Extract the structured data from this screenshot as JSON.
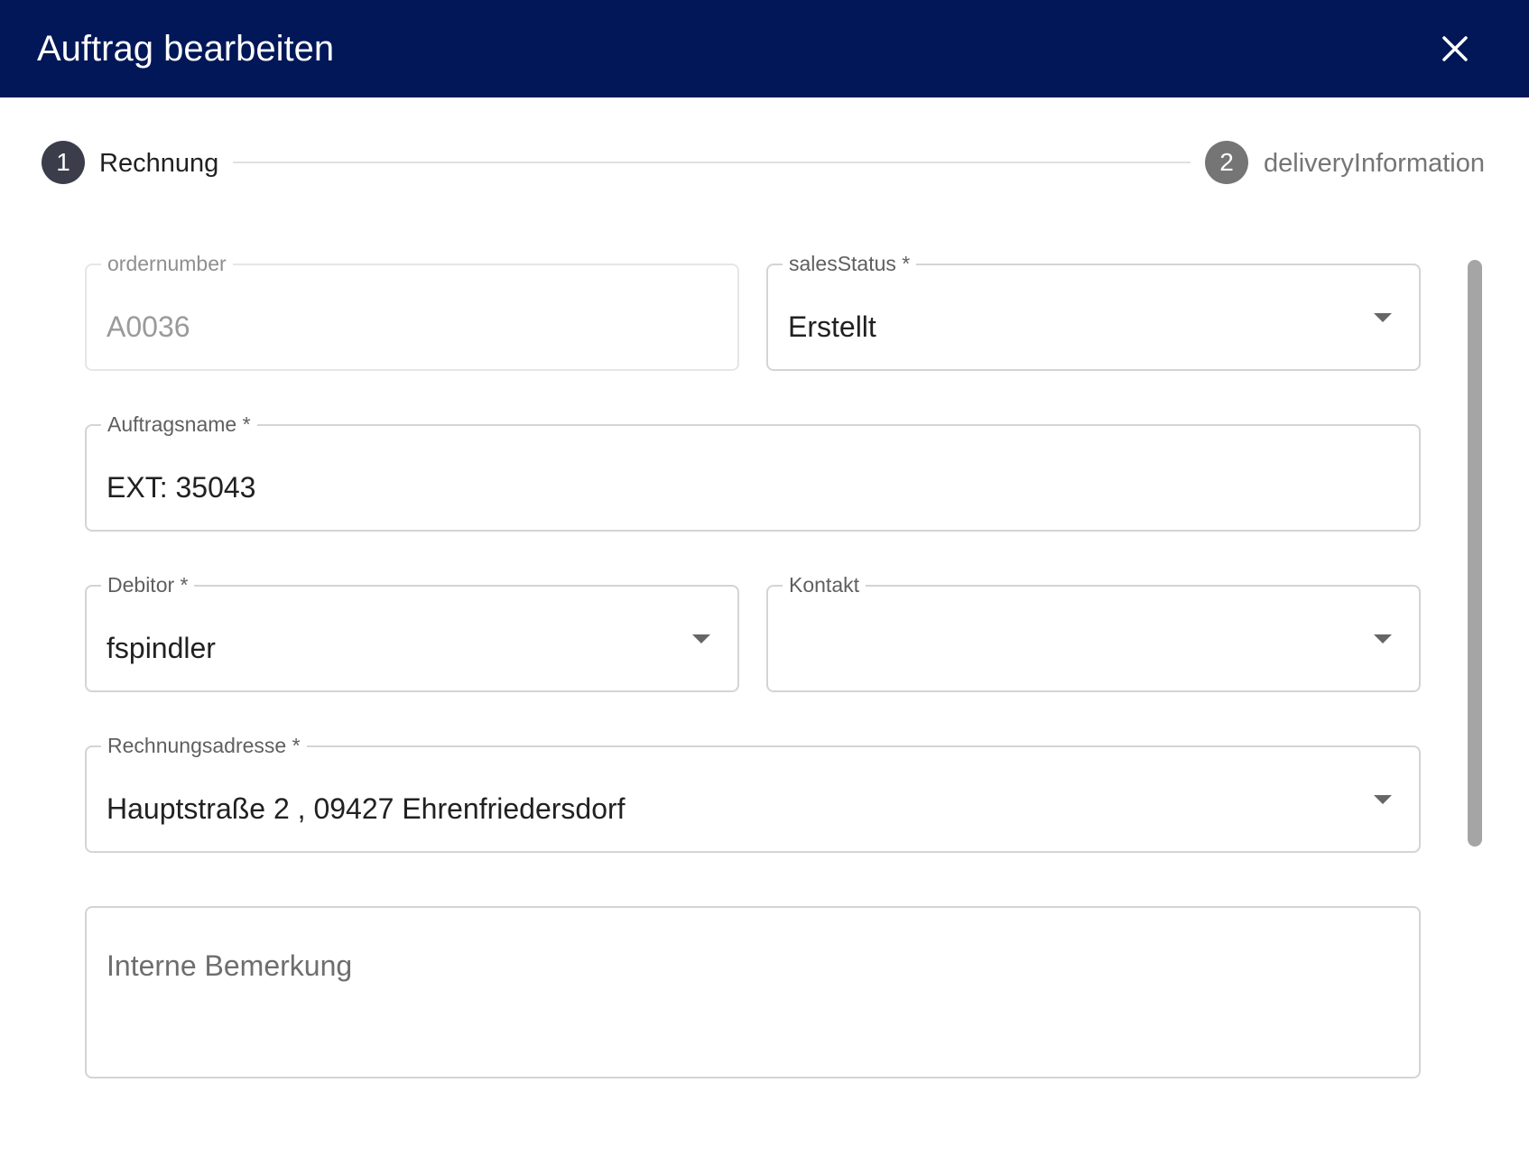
{
  "header": {
    "title": "Auftrag bearbeiten",
    "close_icon": "close-icon"
  },
  "stepper": {
    "steps": [
      {
        "number": "1",
        "label": "Rechnung",
        "active": true
      },
      {
        "number": "2",
        "label": "deliveryInformation",
        "active": false
      }
    ]
  },
  "form": {
    "ordernumber": {
      "label": "ordernumber",
      "value": "A0036",
      "disabled": true
    },
    "salesStatus": {
      "label": "salesStatus *",
      "value": "Erstellt"
    },
    "auftragsname": {
      "label": "Auftragsname *",
      "value": "EXT: 35043"
    },
    "debitor": {
      "label": "Debitor *",
      "value": "fspindler"
    },
    "kontakt": {
      "label": "Kontakt",
      "value": ""
    },
    "rechnungsadresse": {
      "label": "Rechnungsadresse *",
      "value": "Hauptstraße 2 , 09427 Ehrenfriedersdorf"
    },
    "bemerkung": {
      "placeholder": "Interne Bemerkung"
    }
  },
  "colors": {
    "header_bg": "#011757",
    "step_active": "#3b3e4a",
    "step_inactive": "#757575"
  }
}
